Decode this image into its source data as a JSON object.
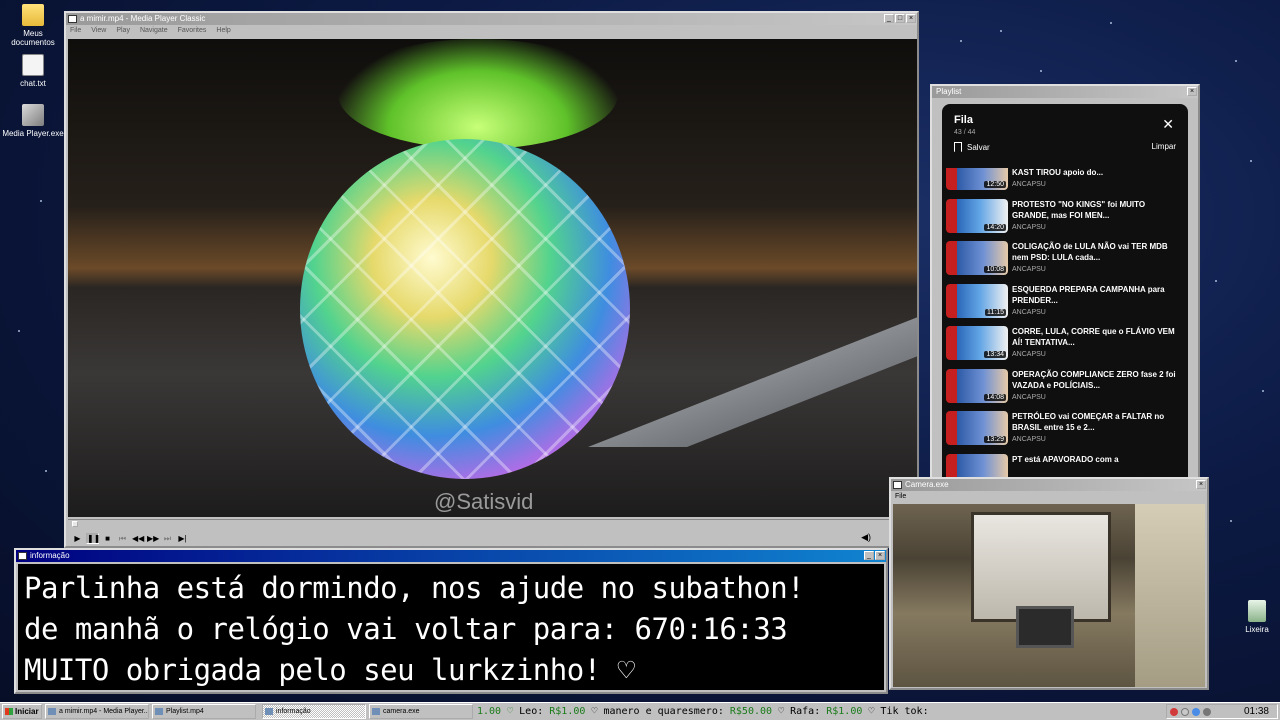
{
  "desktop": {
    "icons": [
      {
        "label": "Meus documentos",
        "icon": "folder-icon"
      },
      {
        "label": "chat.txt",
        "icon": "text-file-icon"
      },
      {
        "label": "Media Player.exe",
        "icon": "media-player-icon"
      },
      {
        "label": "Lixeira",
        "icon": "recycle-bin-icon"
      }
    ]
  },
  "media_player": {
    "title": "a mimir.mp4 - Media Player Classic",
    "menu": [
      "File",
      "View",
      "Play",
      "Navigate",
      "Favorites",
      "Help"
    ],
    "watermark": "@Satisvid",
    "controls": [
      "play",
      "pause",
      "stop",
      "skip-back",
      "rewind",
      "fast-forward",
      "skip-forward",
      "frame-step"
    ]
  },
  "playlist": {
    "window_title": "Playlist",
    "title": "Fila",
    "count": "43 / 44",
    "save_label": "Salvar",
    "clear_label": "Limpar",
    "items": [
      {
        "title": "LULA apostou na BACHELET e agora KAST TIROU apoio do...",
        "duration": "12:50",
        "channel": "ANCAPSU"
      },
      {
        "title": "PROTESTO \"NO KINGS\" foi MUITO GRANDE, mas FOI MEN...",
        "duration": "14:20",
        "channel": "ANCAPSU"
      },
      {
        "title": "COLIGAÇÃO de LULA NÃO vai TER MDB nem PSD: LULA cada...",
        "duration": "10:08",
        "channel": "ANCAPSU"
      },
      {
        "title": "ESQUERDA PREPARA CAMPANHA para PRENDER...",
        "duration": "11:15",
        "channel": "ANCAPSU"
      },
      {
        "title": "CORRE, LULA, CORRE que o FLÁVIO VEM AÍ! TENTATIVA...",
        "duration": "13:34",
        "channel": "ANCAPSU"
      },
      {
        "title": "OPERAÇÃO COMPLIANCE ZERO fase 2 foi VAZADA e POLÍCIAIS...",
        "duration": "14:08",
        "channel": "ANCAPSU"
      },
      {
        "title": "PETRÓLEO vai COMEÇAR a FALTAR no BRASIL entre 15 e 2...",
        "duration": "13:29",
        "channel": "ANCAPSU"
      },
      {
        "title": "PT está APAVORADO com a",
        "duration": "",
        "channel": ""
      }
    ]
  },
  "camera": {
    "title": "Camera.exe",
    "menu": [
      "File"
    ]
  },
  "info": {
    "title": "informação",
    "lines": [
      "Parlinha está dormindo, nos ajude no subathon!",
      "de manhã o relógio vai voltar para:  670:16:33",
      "MUITO obrigada pelo seu lurkzinho! ♡"
    ]
  },
  "taskbar": {
    "start_label": "Iniciar",
    "tasks": [
      {
        "label": "a mimir.mp4 - Media Player...",
        "active": false
      },
      {
        "label": "Playlist.mp4",
        "active": false
      },
      {
        "label": "informação",
        "active": true
      },
      {
        "label": "camera.exe",
        "active": false
      }
    ],
    "ticker": [
      {
        "text": "1.00 ♡     ",
        "highlight": true
      },
      {
        "text": "Leo: ",
        "highlight": false
      },
      {
        "text": "R$1.00",
        "highlight": true
      },
      {
        "text": " ♡     manero e quaresmero: ",
        "highlight": false
      },
      {
        "text": "R$50.00",
        "highlight": true
      },
      {
        "text": " ♡     Rafa: ",
        "highlight": false
      },
      {
        "text": "R$1.00",
        "highlight": true
      },
      {
        "text": " ♡     Tik tok: ",
        "highlight": false
      }
    ],
    "clock": "01:38"
  },
  "colors": {
    "titlebar_active": "#000080",
    "ticker_highlight": "#1a7b1a",
    "youtube_bg": "#0f0f0f"
  }
}
